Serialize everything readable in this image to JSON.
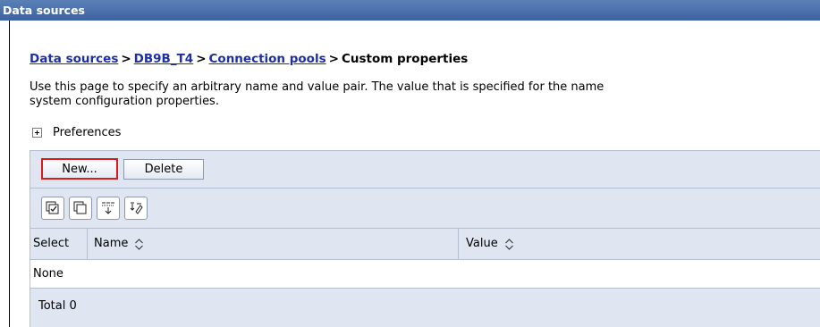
{
  "window": {
    "title": "Data sources"
  },
  "breadcrumb": {
    "items": [
      "Data sources",
      "DB9B_T4",
      "Connection pools"
    ],
    "current": "Custom properties",
    "separator": ">"
  },
  "description": {
    "line1": "Use this page to specify an arbitrary name and value pair. The value that is specified for the name",
    "line2": "system configuration properties."
  },
  "preferences": {
    "label": "Preferences",
    "icon": "plus-expand-icon"
  },
  "toolbar": {
    "new_label": "New...",
    "delete_label": "Delete"
  },
  "icon_toolbar": [
    "select-all-icon",
    "deselect-all-icon",
    "show-filter-icon",
    "clear-filter-icon"
  ],
  "table": {
    "columns": [
      "Select",
      "Name",
      "Value"
    ],
    "empty_text": "None",
    "total_text": "Total 0"
  },
  "colors": {
    "title_bar": "#4a6fab",
    "link": "#1c2fa6",
    "table_bg": "#dfe6f1",
    "highlight": "#d81c1c"
  }
}
